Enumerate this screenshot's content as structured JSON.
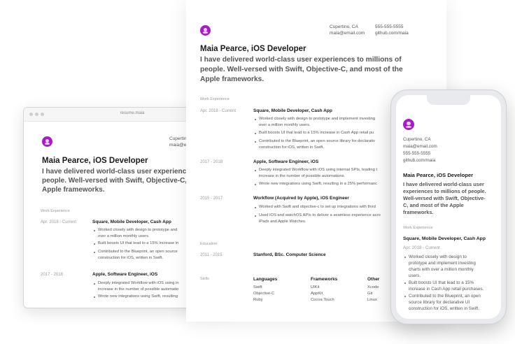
{
  "contact": {
    "city": "Cupertino, CA",
    "email": "maia@email.com",
    "phone": "555-555-5555",
    "github": "github.com/maia",
    "city_trunc": "Cupertin",
    "email_trunc": "maia@em"
  },
  "browser": {
    "url": "resume.maia"
  },
  "name_title": "Maia Pearce, iOS Developer",
  "summary": "I have delivered world-class user experiences to millions of people. Well-versed with Swift, Objective-C, and most of the Apple frameworks.",
  "doc_summary_lines": [
    "I have delivered world-class user experiences to millions of",
    "people. Well-versed with Swift, Objective-C, and most of the",
    "Apple frameworks."
  ],
  "browser_summary_lines": [
    "I have delivered world-class user experience",
    "people. Well-versed with Swift, Objective-C,",
    "Apple frameworks."
  ],
  "phone_summary_lines": [
    "I have delivered world-class user",
    "experiences to millions of people.",
    "Well-versed with Swift, Objective-",
    "C, and most of the Apple",
    "frameworks."
  ],
  "sections": {
    "work": "Work Experience",
    "education": "Education",
    "skills": "Skills"
  },
  "jobs": [
    {
      "dates": "Apr. 2018 - Current",
      "title": "Square, Mobile Developer, Cash App",
      "doc_bullets": [
        "Worked closely with design to prototype and implement investing",
        "over a million monthly users.",
        "Built boosts UI that lead to a 15% increase in Cash App retail pu",
        "Contributed to the Blueprint, an open source library for declarativ",
        "construction for iOS, written in Swift."
      ],
      "browser_bullets": [
        "Worked closely with design to prototype and",
        "over a million monthly users.",
        "Built boosts UI that lead to a 15% increase in",
        "Contributed to the Blueprint, an open source",
        "construction for iOS, written in Swift."
      ],
      "phone_bullets": [
        "Worked closely with design to",
        "prototype and implement investing",
        "charts with over a million monthly",
        "users.",
        "Built boosts UI that lead to a 15%",
        "increase in Cash App retail purchases.",
        "Contributed to the Blueprint, an open",
        "source library for declarative UI",
        "construction for iOS, written in Swift."
      ]
    },
    {
      "dates": "2017 - 2018",
      "title": "Apple, Software Engineer, iOS",
      "doc_bullets": [
        "Deeply integrated Workflow with iOS using internal SPIs, leading t",
        "increase in the number of possible automations.",
        "Wrote new integrations using Swift, resulting in a 25% performanc"
      ],
      "browser_bullets": [
        "Deeply integrated Workflow with iOS using in",
        "increase in the number of possible automatio",
        "Wrote new integrations using Swift, resulting"
      ]
    },
    {
      "dates": "2015 - 2017",
      "title": "Workflow (Acquired by Apple), iOS Engineer",
      "doc_bullets": [
        "Worked with Swift and objective-c to set up integrations with third",
        "Used iOS and watchOS APIs to deliver a seamless experience acro",
        "iPads and Apple Watches."
      ]
    }
  ],
  "education": {
    "dates": "2011 - 2015",
    "school": "Stanford, BSc. Computer Science"
  },
  "skills": {
    "columns": [
      {
        "heading": "Languages",
        "items": [
          "Swift",
          "Objective-C",
          "Ruby"
        ]
      },
      {
        "heading": "Frameworks",
        "items": [
          "UIKit",
          "AppKit",
          "Cocoa Touch"
        ]
      },
      {
        "heading": "Other",
        "items": [
          "Xcode",
          "Git",
          "Linux"
        ]
      }
    ]
  },
  "colors": {
    "accent": "#a21fc4",
    "avatar_face": "#f2c9ff",
    "muted": "#9a9a9a"
  }
}
